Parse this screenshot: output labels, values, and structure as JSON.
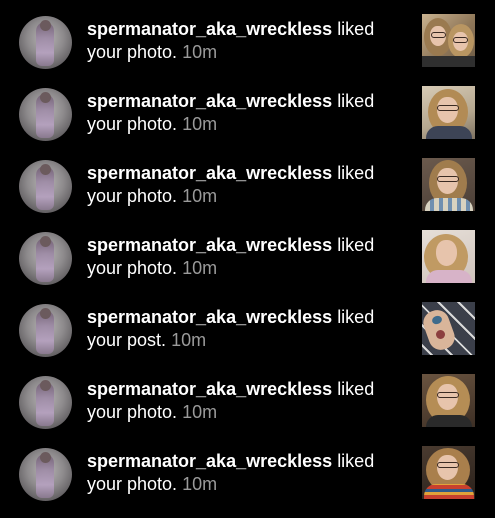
{
  "notifications": [
    {
      "username": "spermanator_aka_wreckless",
      "action": "liked your photo.",
      "time": "10m",
      "thumb_icon": "photo-two-people-selfie"
    },
    {
      "username": "spermanator_aka_wreckless",
      "action": "liked your photo.",
      "time": "10m",
      "thumb_icon": "photo-selfie-glasses"
    },
    {
      "username": "spermanator_aka_wreckless",
      "action": "liked your photo.",
      "time": "10m",
      "thumb_icon": "photo-selfie-glasses"
    },
    {
      "username": "spermanator_aka_wreckless",
      "action": "liked your photo.",
      "time": "10m",
      "thumb_icon": "photo-selfie-curly-hair"
    },
    {
      "username": "spermanator_aka_wreckless",
      "action": "liked your post.",
      "time": "10m",
      "thumb_icon": "photo-tattooed-arm"
    },
    {
      "username": "spermanator_aka_wreckless",
      "action": "liked your photo.",
      "time": "10m",
      "thumb_icon": "photo-selfie-glasses"
    },
    {
      "username": "spermanator_aka_wreckless",
      "action": "liked your photo.",
      "time": "10m",
      "thumb_icon": "photo-selfie-striped-shirt"
    }
  ],
  "colors": {
    "background": "#000000",
    "text": "#ffffff",
    "timestamp": "#9a9a9a"
  }
}
